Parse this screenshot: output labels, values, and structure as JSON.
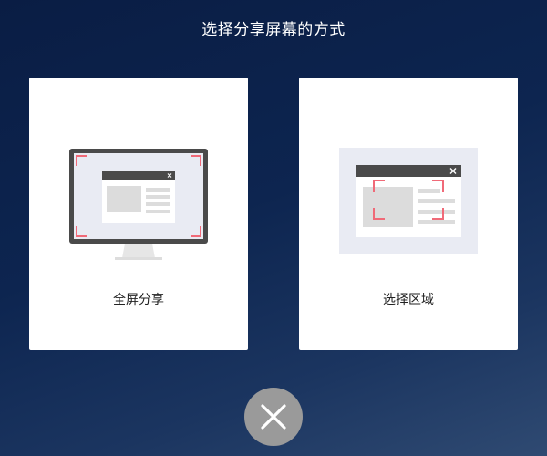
{
  "page": {
    "title": "选择分享屏幕的方式"
  },
  "options": {
    "full_screen": {
      "label": "全屏分享",
      "icon": "monitor-fullscreen-icon"
    },
    "region": {
      "label": "选择区域",
      "icon": "window-region-icon"
    }
  },
  "close_button": {
    "icon": "close-icon"
  },
  "colors": {
    "background": "#0d2550",
    "card": "#ffffff",
    "accent_corner": "#f06a78",
    "monitor_frame": "#4a4a4a",
    "close_button": "#9a9a9a"
  }
}
